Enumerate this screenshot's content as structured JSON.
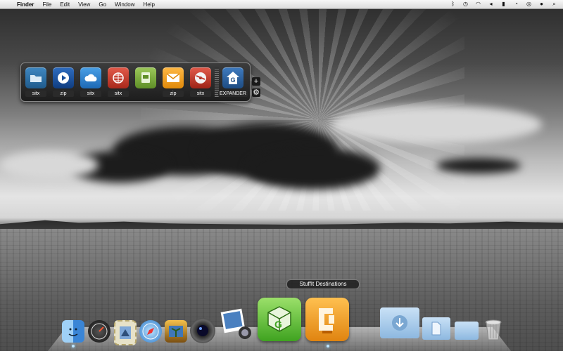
{
  "menubar": {
    "apple_symbol": "",
    "items": [
      "Finder",
      "File",
      "Edit",
      "View",
      "Go",
      "Window",
      "Help"
    ],
    "status_icons": [
      "bluetooth-icon",
      "time-machine-icon",
      "wifi-icon",
      "volume-icon",
      "battery-icon",
      "clock-icon",
      "search-icon",
      "user-icon",
      "spotlight-icon"
    ]
  },
  "stuffit_panel": {
    "tiles": [
      {
        "label": "sitx",
        "icon": "folder-icon",
        "color": "#2a6fa5"
      },
      {
        "label": "zip",
        "icon": "play-icon",
        "color": "#1a4f9a"
      },
      {
        "label": "sitx",
        "icon": "cloud-icon",
        "color": "#2a7bc5"
      },
      {
        "label": "sitx",
        "icon": "web-icon",
        "color": "#c0392b"
      },
      {
        "label": "",
        "icon": "document-icon",
        "color": "#7aa93a"
      },
      {
        "label": "zip",
        "icon": "mail-icon",
        "color": "#f39c12"
      },
      {
        "label": "sitx",
        "icon": "disc-icon",
        "color": "#c0392b"
      },
      {
        "label": "EXPANDER",
        "icon": "expander-icon",
        "color": "#2c5f93"
      }
    ],
    "add_symbol": "+",
    "gear_symbol": "⚙"
  },
  "dock": {
    "tooltip": "StuffIt Destinations",
    "apps": [
      "finder-icon",
      "dashboard-icon",
      "mail-stamp-icon",
      "safari-icon",
      "iphoto-icon",
      "facetime-camera-icon",
      "photo-booth-icon",
      "stuffit-cube-icon",
      "stuffit-clamp-icon",
      "downloads-folder-icon",
      "documents-folder-icon",
      "folder-icon",
      "trash-icon"
    ]
  }
}
